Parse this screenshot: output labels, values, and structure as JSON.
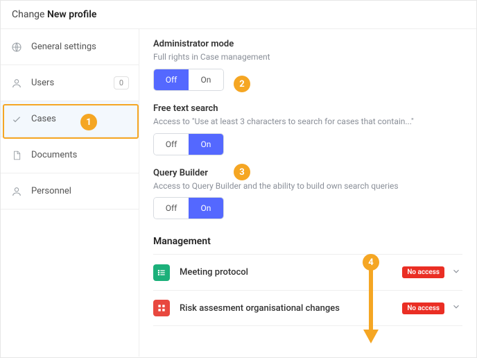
{
  "header": {
    "prefix": "Change",
    "title": "New profile"
  },
  "sidebar": {
    "items": [
      {
        "label": "General settings"
      },
      {
        "label": "Users",
        "count": "0"
      },
      {
        "label": "Cases"
      },
      {
        "label": "Documents"
      },
      {
        "label": "Personnel"
      }
    ]
  },
  "settings": {
    "admin": {
      "title": "Administrator mode",
      "desc": "Full rights in Case management",
      "off": "Off",
      "on": "On"
    },
    "search": {
      "title": "Free text search",
      "desc": "Access to \"Use at least 3 characters to search for cases that contain...\"",
      "off": "Off",
      "on": "On"
    },
    "query": {
      "title": "Query Builder",
      "desc": "Access to Query Builder and the ability to build own search queries",
      "off": "Off",
      "on": "On"
    }
  },
  "management": {
    "title": "Management",
    "rows": [
      {
        "name": "Meeting protocol",
        "badge": "No access"
      },
      {
        "name": "Risk assesment organisational changes",
        "badge": "No access"
      }
    ]
  },
  "annotations": {
    "n1": "1",
    "n2": "2",
    "n3": "3",
    "n4": "4"
  }
}
